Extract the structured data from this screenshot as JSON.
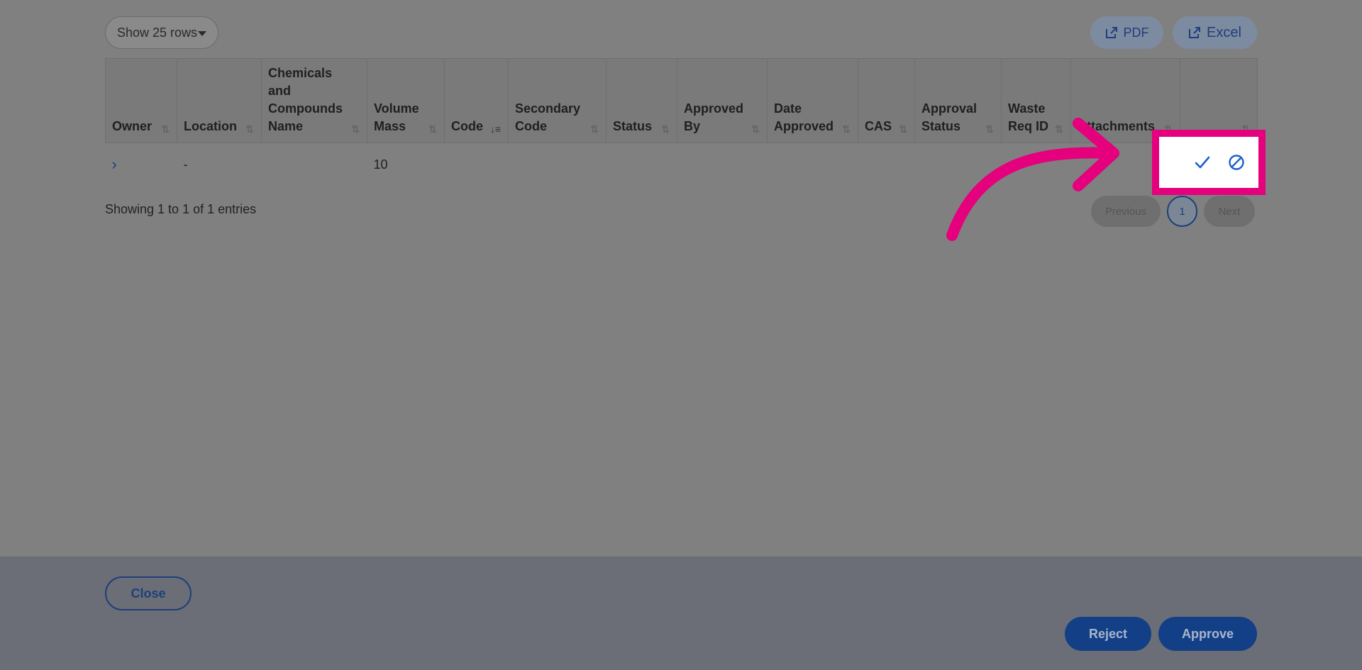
{
  "toolbar": {
    "rows_select_label": "Show 25 rows",
    "pdf_label": "PDF",
    "excel_label": "Excel"
  },
  "table": {
    "columns": [
      "Owner",
      "Location",
      "Chemicals and Compounds Name",
      "Volume Mass",
      "Code",
      "Secondary Code",
      "Status",
      "Approved By",
      "Date Approved",
      "CAS",
      "Approval Status",
      "Waste Req ID",
      "Attachments",
      ""
    ],
    "rows": [
      {
        "owner": "",
        "location": "-",
        "chemicals_name": "",
        "volume_mass": "10",
        "code": "",
        "secondary_code": "",
        "status": "",
        "approved_by": "",
        "date_approved": "",
        "cas": "",
        "approval_status": "",
        "waste_req_id": "",
        "attachments": ""
      }
    ]
  },
  "pagination": {
    "info": "Showing 1 to 1 of 1 entries",
    "previous_label": "Previous",
    "current_page": "1",
    "next_label": "Next"
  },
  "footer": {
    "close_label": "Close",
    "reject_label": "Reject",
    "approve_label": "Approve"
  },
  "colors": {
    "accent": "#1e3f7a",
    "highlight": "#e5007e"
  },
  "icons": {
    "expand": "chevron-right-icon",
    "approve_row": "check-icon",
    "reject_row": "ban-icon",
    "export": "export-icon"
  }
}
